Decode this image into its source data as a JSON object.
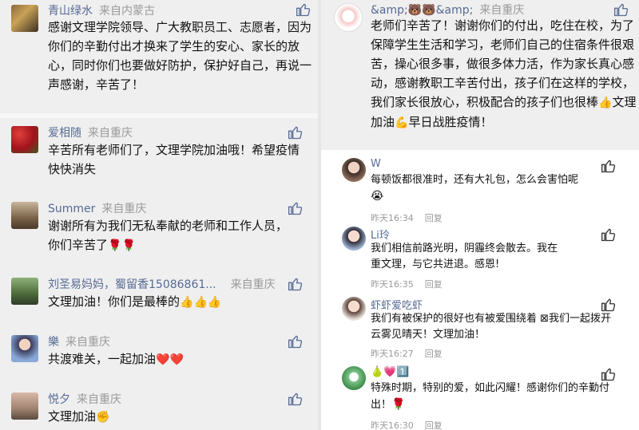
{
  "left": {
    "comments": [
      {
        "name": "青山绿水",
        "location": "来自内蒙古",
        "text": "感谢文理学院领导、广大教职员工、志愿者，因为你们的辛勤付出才换来了学生的安心、家长的放心，同时你们也要做好防护，保护好自己，再说一声感谢，辛苦了！"
      },
      {
        "name": "爱相随",
        "location": "来自重庆",
        "text": "辛苦所有老师们了，文理学院加油哦！希望疫情快快消失"
      },
      {
        "name": "Summer",
        "location": "来自重庆",
        "text": "谢谢所有为我们无私奉献的老师和工作人员，你们辛苦了",
        "emoji": "🌹🌹"
      },
      {
        "name": "刘圣易妈妈，蜀留香15086861...",
        "location": "来自重庆",
        "text": "文理加油！你们是最棒的",
        "emoji": "👍👍👍"
      },
      {
        "name": "樂",
        "location": "来自重庆",
        "text": "共渡难关，一起加油",
        "emoji": "❤️❤️"
      },
      {
        "name": "悦夕",
        "location": "来自重庆",
        "text": "文理加油",
        "emoji": "✊"
      }
    ]
  },
  "right": {
    "top_comment": {
      "name": "&amp;🐻🐻&amp;",
      "location": "来自重庆",
      "text": "老师们辛苦了！谢谢你们的付出，吃住在校，为了保障学生生活和学习，老师们自己的住宿条件很艰苦，操心很多事，做很多体力活，作为家长真心感动，感谢教职工辛苦付出，孩子们在这样的学校，我们家长很放心，积极配合的孩子们也很棒",
      "tail_emoji_1": "👍",
      "tail_text": "文理加油",
      "tail_emoji_2": "💪",
      "tail_text_2": "早日战胜疫情！"
    },
    "replies": [
      {
        "name": "W",
        "text": "每顿饭都很准时，还有大礼包，怎么会害怕呢",
        "emoji": "😭",
        "time": "昨天16:34",
        "reply": "回复"
      },
      {
        "name": "Li玲",
        "text": "我们相信前路光明，阴霾终会散去。我在重文理，与它共进退。感恩!",
        "time": "昨天16:35",
        "reply": "回复"
      },
      {
        "name": "虾虾爱吃虾",
        "text": "我们有被保护的很好也有被爱围绕着 ⊠我们一起拨开云雾见晴天！文理加油！",
        "time": "昨天16:27",
        "reply": "回复"
      },
      {
        "name": "🍐💗1️⃣",
        "text": "特殊时期，特别的爱，如此闪耀！感谢你们的辛勤付出！",
        "emoji": "🌹",
        "time": "昨天16:30",
        "reply": "回复"
      }
    ]
  },
  "icons": {
    "like": "thumbs-up-icon"
  }
}
